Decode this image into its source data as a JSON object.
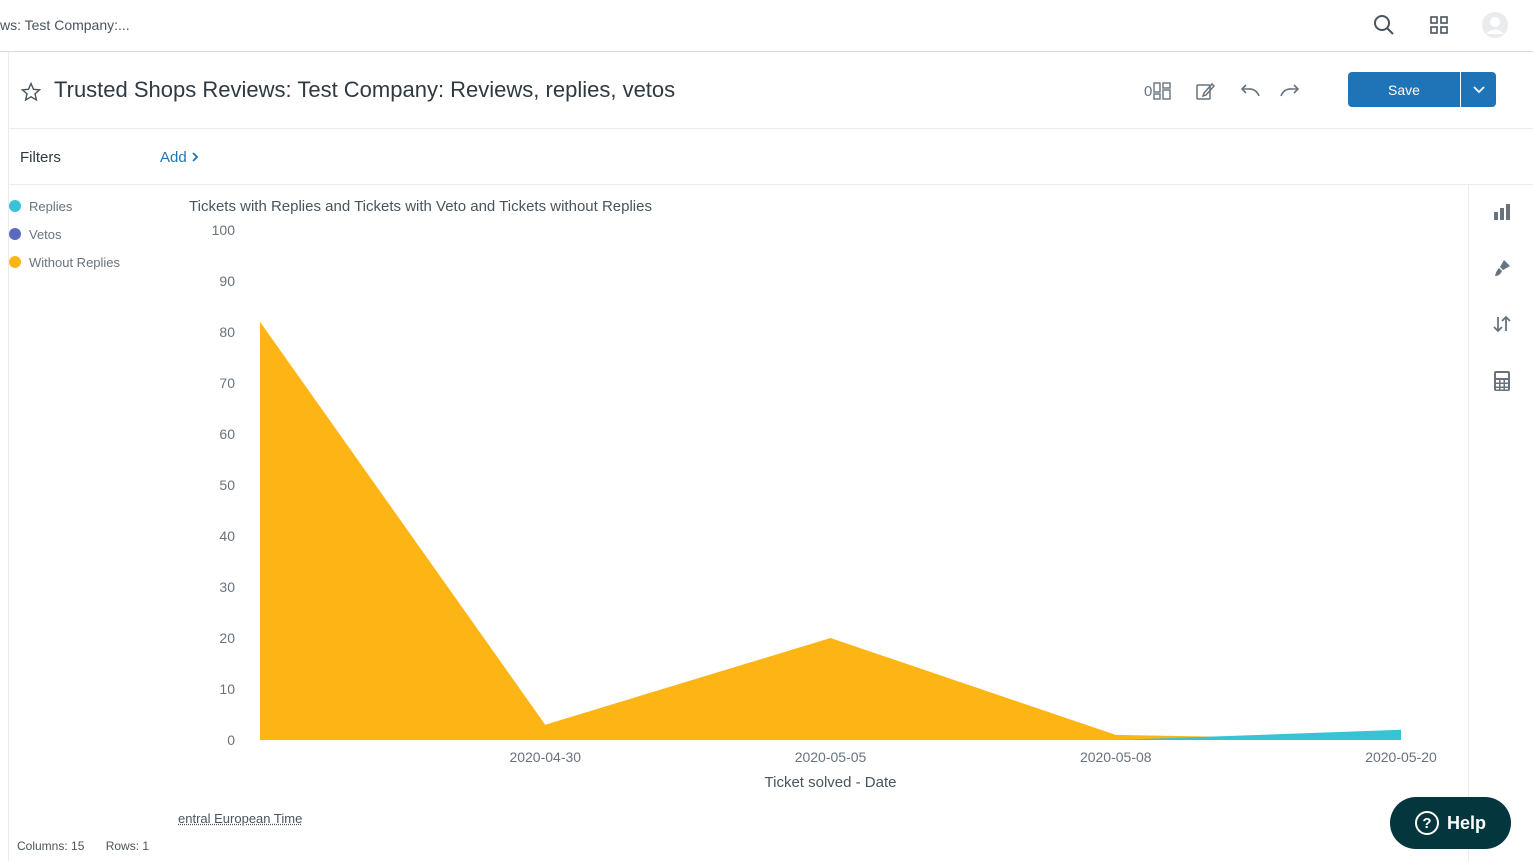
{
  "topbar": {
    "breadcrumb": "ws: Test Company:..."
  },
  "report": {
    "title": "Trusted Shops Reviews: Test Company: Reviews, replies, vetos",
    "widget_count": "0",
    "save_label": "Save"
  },
  "filters": {
    "label": "Filters",
    "add_label": "Add"
  },
  "legend": [
    {
      "label": "Replies",
      "color": "#38c2d6"
    },
    {
      "label": "Vetos",
      "color": "#5b6abf"
    },
    {
      "label": "Without Replies",
      "color": "#fdb515"
    }
  ],
  "chart_data": {
    "type": "area",
    "title": "Tickets with Replies and Tickets with Veto and Tickets without Replies",
    "xlabel": "Ticket solved - Date",
    "ylabel": "",
    "ylim": [
      0,
      100
    ],
    "yticks": [
      0,
      10,
      20,
      30,
      40,
      50,
      60,
      70,
      80,
      90,
      100
    ],
    "x": [
      "",
      "2020-04-30",
      "2020-05-05",
      "2020-05-08",
      "2020-05-20"
    ],
    "series": [
      {
        "name": "Without Replies",
        "color": "#fdb515",
        "values": [
          82,
          3,
          20,
          1,
          0
        ]
      },
      {
        "name": "Vetos",
        "color": "#5b6abf",
        "values": [
          0,
          0,
          0,
          0,
          0
        ]
      },
      {
        "name": "Replies",
        "color": "#38c2d6",
        "values": [
          0,
          0,
          0,
          0,
          2
        ]
      }
    ]
  },
  "timezone_label": "entral European Time",
  "footer": {
    "columns": "Columns: 15",
    "rows": "Rows: 1"
  },
  "help_label": "Help"
}
